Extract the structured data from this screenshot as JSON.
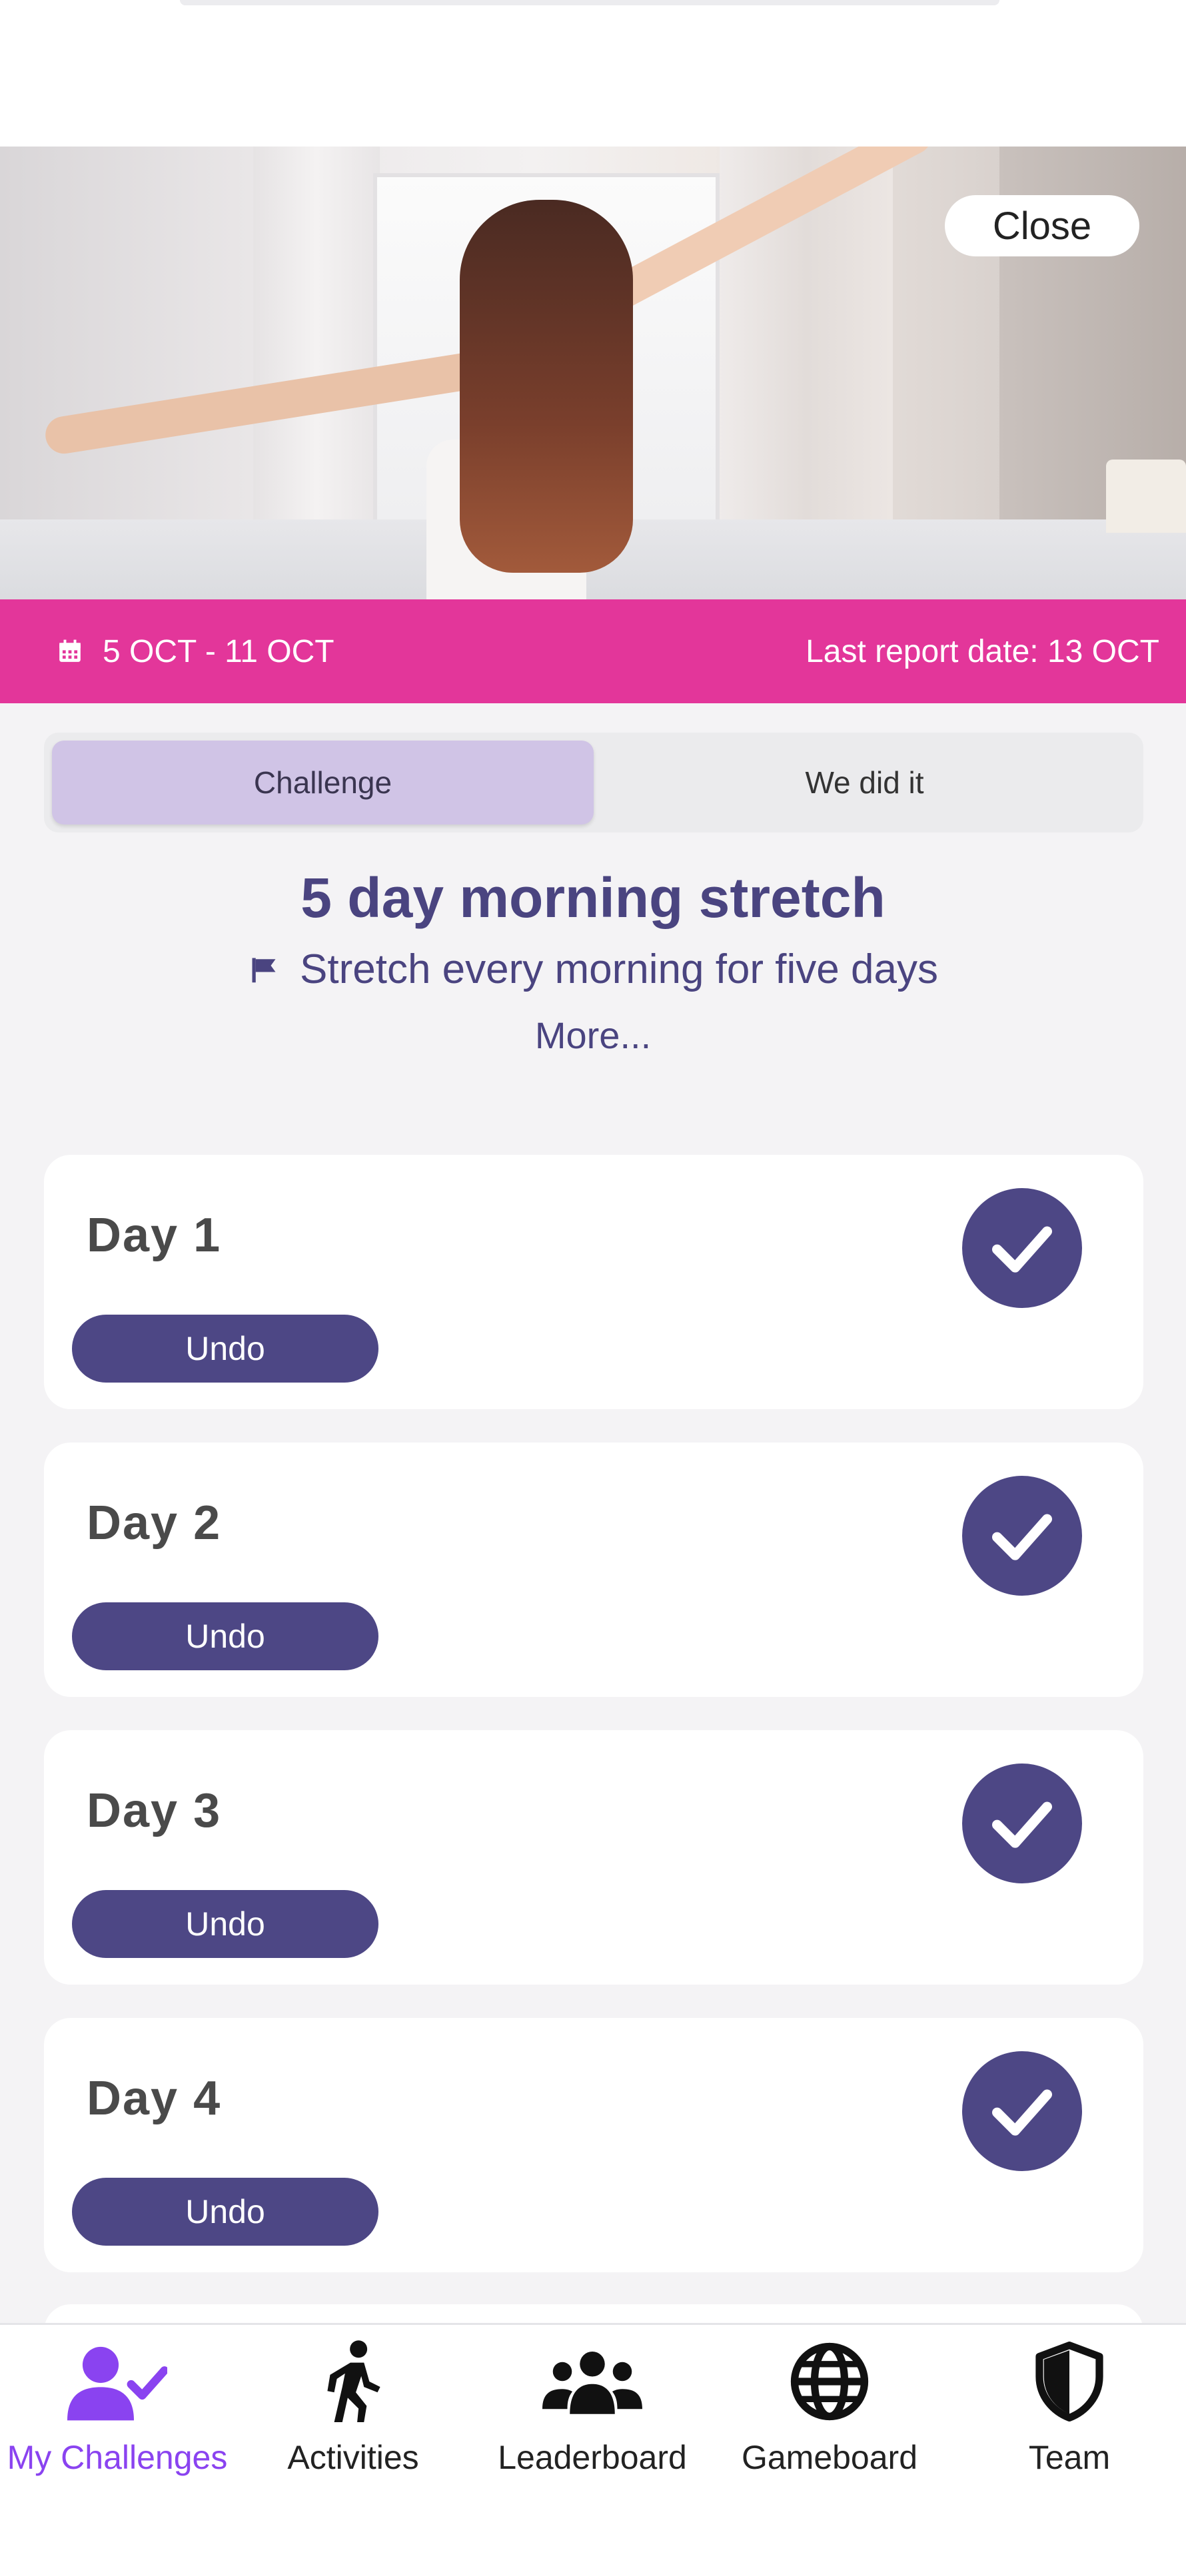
{
  "hero": {
    "close_label": "Close"
  },
  "date_bar": {
    "range": "5 OCT - 11 OCT",
    "last_report": "Last report date: 13 OCT",
    "color": "#e3369a"
  },
  "tabs": {
    "challenge": "Challenge",
    "we_did_it": "We did it",
    "active": "challenge"
  },
  "challenge": {
    "title": "5 day morning stretch",
    "description": "Stretch every morning for five days",
    "more": "More..."
  },
  "days": [
    {
      "label": "Day  1",
      "undo": "Undo",
      "completed": true
    },
    {
      "label": "Day  2",
      "undo": "Undo",
      "completed": true
    },
    {
      "label": "Day  3",
      "undo": "Undo",
      "completed": true
    },
    {
      "label": "Day  4",
      "undo": "Undo",
      "completed": true
    }
  ],
  "nav": [
    {
      "label": "My Challenges",
      "icon": "user-check-icon",
      "active": true
    },
    {
      "label": "Activities",
      "icon": "walking-icon",
      "active": false
    },
    {
      "label": "Leaderboard",
      "icon": "users-icon",
      "active": false
    },
    {
      "label": "Gameboard",
      "icon": "globe-icon",
      "active": false
    },
    {
      "label": "Team",
      "icon": "shield-icon",
      "active": false
    }
  ],
  "colors": {
    "accent": "#4d4785",
    "active_tab": "#8a43f0",
    "segment_active": "#d0c4e6"
  }
}
